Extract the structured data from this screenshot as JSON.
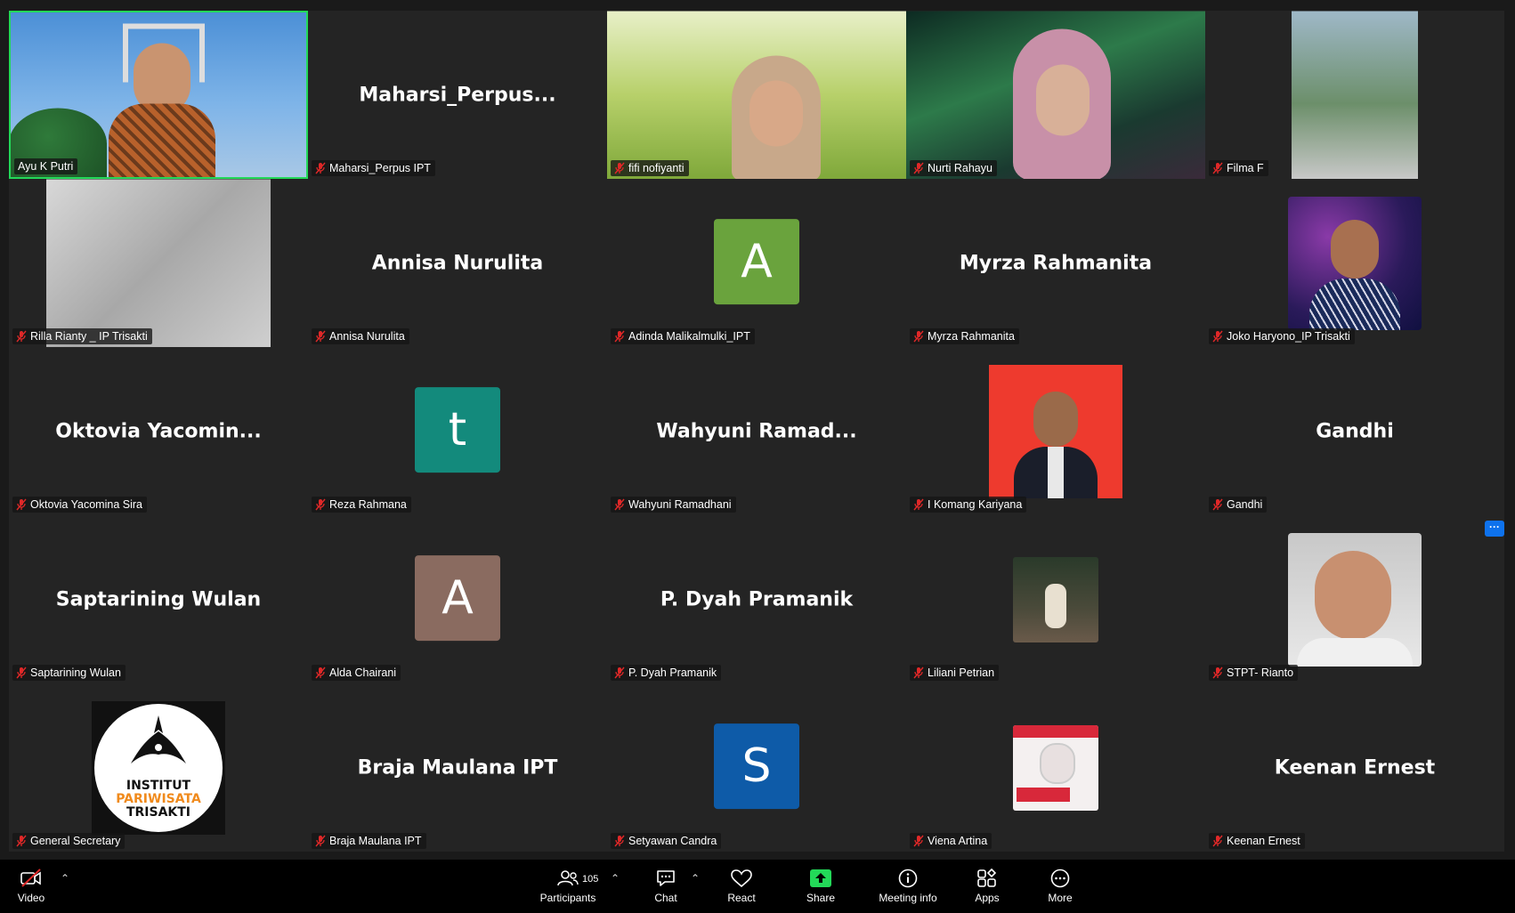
{
  "colors": {
    "active_border": "#23d959",
    "tile_bg": "#242424",
    "avatar_green": "#6aa33d",
    "avatar_teal": "#138a7c",
    "avatar_brown": "#8a6b60",
    "avatar_blue": "#0e5ba8",
    "share_green": "#23d959"
  },
  "participants": [
    {
      "label": "Ayu K Putri"
    },
    {
      "label": "Maharsi_Perpus IPT",
      "display": "Maharsi_Perpus..."
    },
    {
      "label": "fifi nofiyanti"
    },
    {
      "label": "Nurti Rahayu"
    },
    {
      "label": "Filma F"
    },
    {
      "label": "Rilla Rianty _ IP Trisakti"
    },
    {
      "label": "Annisa Nurulita",
      "display": "Annisa Nurulita"
    },
    {
      "label": "Adinda Malikalmulki_IPT",
      "avatar": "A"
    },
    {
      "label": "Myrza Rahmanita",
      "display": "Myrza Rahmanita"
    },
    {
      "label": "Joko Haryono_IP Trisakti"
    },
    {
      "label": "Oktovia Yacomina Sira",
      "display": "Oktovia  Yacomin..."
    },
    {
      "label": "Reza Rahmana",
      "avatar": "t"
    },
    {
      "label": "Wahyuni Ramadhani",
      "display": "Wahyuni  Ramad..."
    },
    {
      "label": "I Komang Kariyana"
    },
    {
      "label": "Gandhi",
      "display": "Gandhi"
    },
    {
      "label": "Saptarining Wulan",
      "display": "Saptarining Wulan"
    },
    {
      "label": "Alda Chairani",
      "avatar": "A"
    },
    {
      "label": "P. Dyah Pramanik",
      "display": "P. Dyah Pramanik"
    },
    {
      "label": "Liliani Petrian"
    },
    {
      "label": "STPT- Rianto"
    },
    {
      "label": "General Secretary",
      "logo_lines": [
        "INSTITUT",
        "PARIWISATA",
        "TRISAKTI"
      ]
    },
    {
      "label": "Braja Maulana IPT",
      "display": "Braja Maulana IPT"
    },
    {
      "label": "Setyawan Candra",
      "avatar": "S"
    },
    {
      "label": "Viena Artina"
    },
    {
      "label": "Keenan Ernest",
      "display": "Keenan Ernest"
    }
  ],
  "more_button": "···",
  "toolbar": {
    "video": "Video",
    "participants": "Participants",
    "participant_count": "105",
    "chat": "Chat",
    "react": "React",
    "share": "Share",
    "meeting_info": "Meeting info",
    "apps": "Apps",
    "more": "More"
  }
}
